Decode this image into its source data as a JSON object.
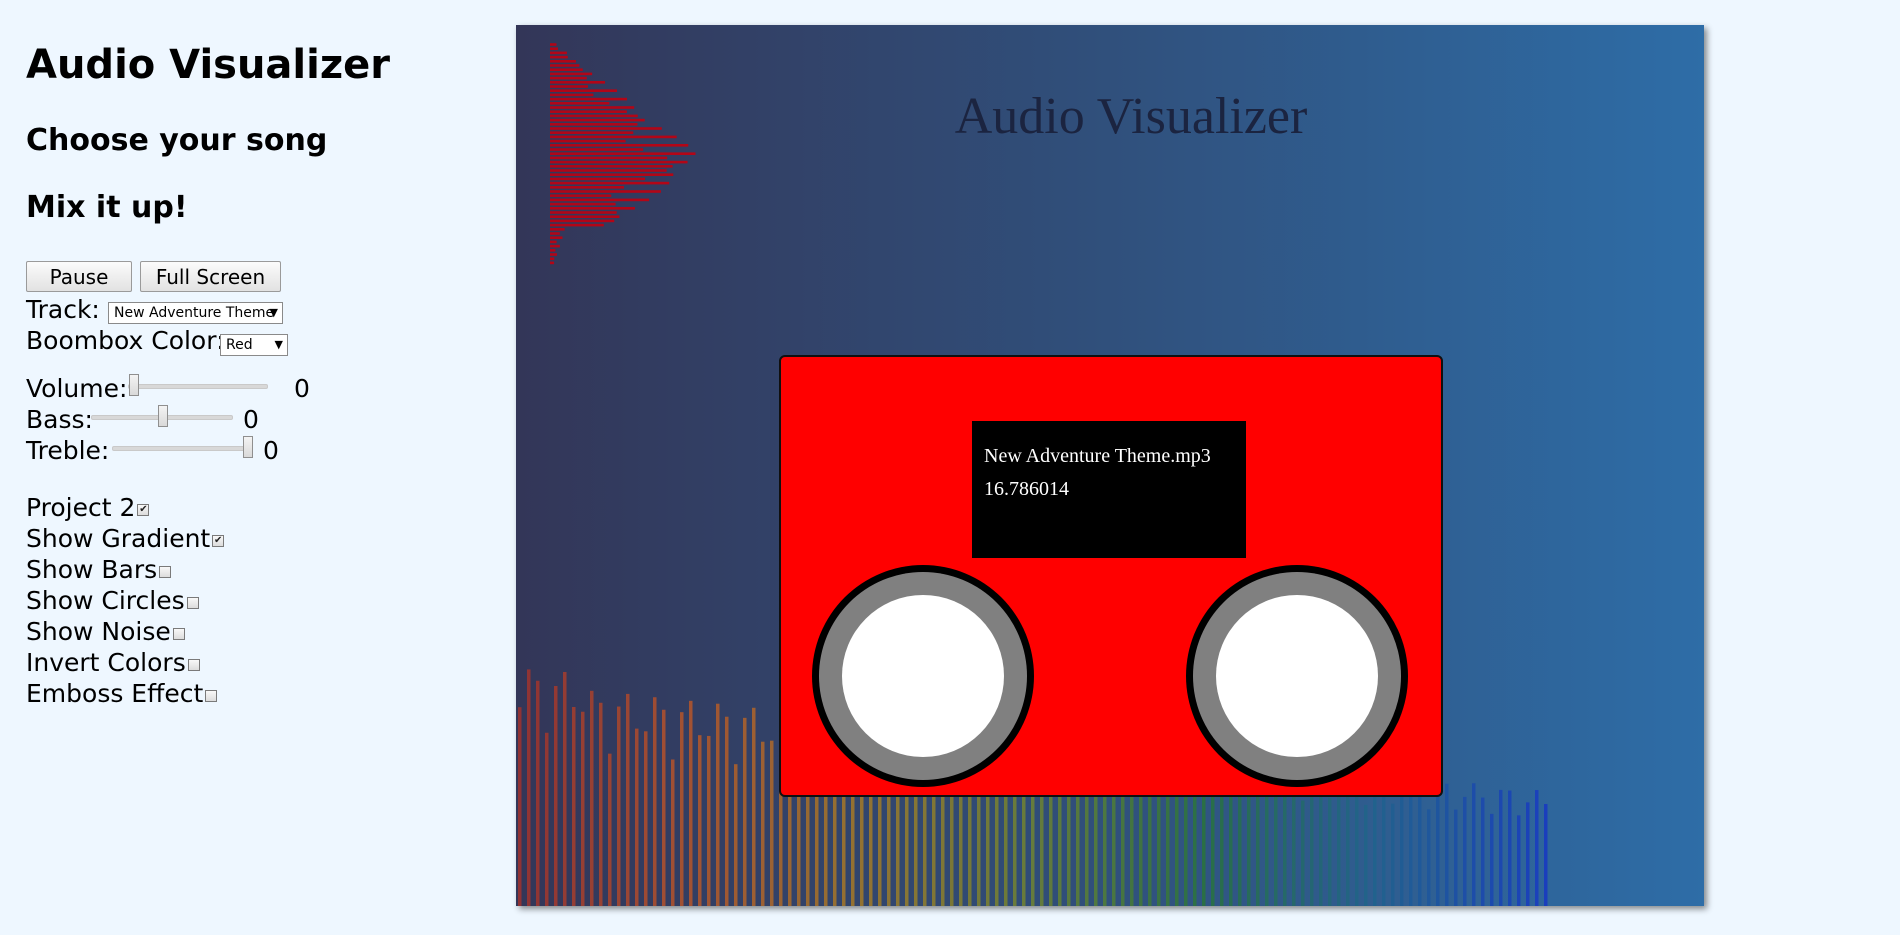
{
  "controls": {
    "title": "Audio Visualizer",
    "choose_heading": "Choose your song",
    "mix_heading": "Mix it up!",
    "pause_label": "Pause",
    "fullscreen_label": "Full Screen",
    "track_label": "Track:",
    "track_value": "New Adventure Theme",
    "boombox_color_label": "Boombox Color:",
    "boombox_color_value": "Red",
    "volume_label": "Volume:",
    "volume_value": "0",
    "volume_level": 0.0,
    "bass_label": "Bass:",
    "bass_value": "0",
    "bass_level": 0.5,
    "treble_label": "Treble:",
    "treble_value": "0",
    "treble_level": 1.0,
    "toggles": [
      {
        "label": "Project 2",
        "checked": true
      },
      {
        "label": "Show Gradient",
        "checked": true
      },
      {
        "label": "Show Bars",
        "checked": false
      },
      {
        "label": "Show Circles",
        "checked": false
      },
      {
        "label": "Show Noise",
        "checked": false
      },
      {
        "label": "Invert Colors",
        "checked": false
      },
      {
        "label": "Emboss Effect",
        "checked": false
      }
    ]
  },
  "stage": {
    "title": "Audio Visualizer",
    "boombox": {
      "color": "#ff0000",
      "filename": "New Adventure Theme.mp3",
      "time": "16.786014"
    },
    "colors": {
      "gradient_start": "#333658",
      "gradient_end": "#2e6da7",
      "left_bars": "#c00010"
    }
  }
}
